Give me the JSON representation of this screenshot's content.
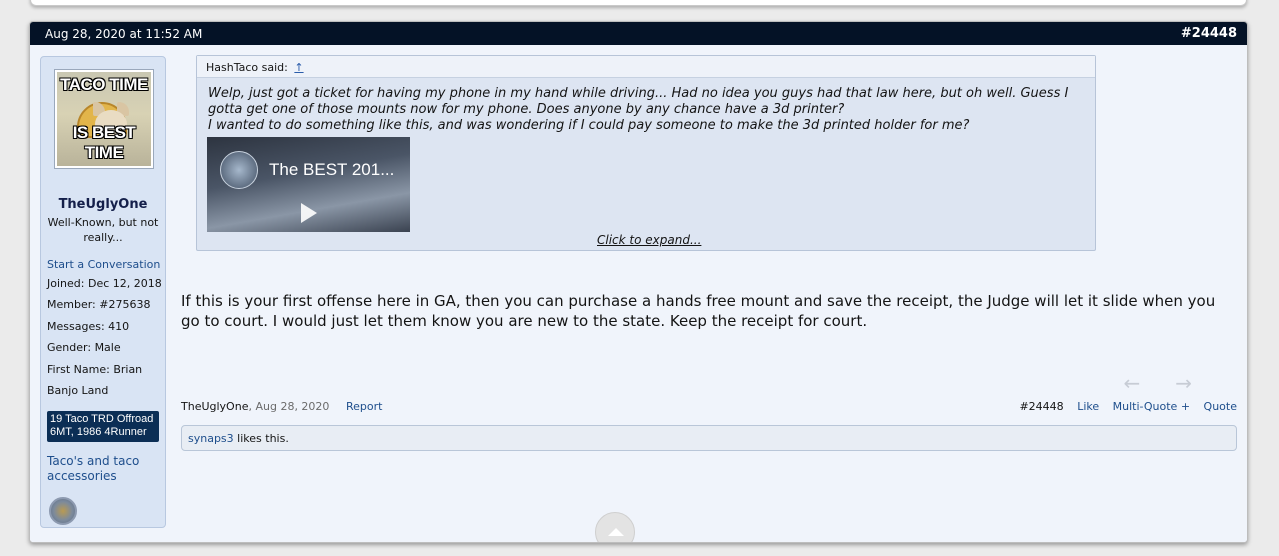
{
  "post": {
    "timestamp": "Aug 28, 2020 at 11:52 AM",
    "number": "#24448"
  },
  "user": {
    "avatar_top_text": "TACO TIME",
    "avatar_bottom_text": "IS BEST TIME",
    "name": "TheUglyOne",
    "title": "Well-Known, but not really...",
    "start_conversation": "Start a Conversation",
    "fields": [
      {
        "label": "Joined:",
        "value": "Dec 12, 2018"
      },
      {
        "label": "Member:",
        "value": "#275638"
      },
      {
        "label": "Messages:",
        "value": "410"
      },
      {
        "label": "Gender:",
        "value": "Male"
      },
      {
        "label": "First Name:",
        "value": "Brian"
      },
      {
        "label": "Banjo Land",
        "value": ""
      }
    ],
    "ride": "19 Taco TRD Offroad 6MT, 1986 4Runner",
    "link": "Taco's and taco accessories"
  },
  "quote": {
    "author_said": "HashTaco said:",
    "arrow": "↑",
    "line1": "Welp, just got a ticket for having my phone in my hand while driving... Had no idea you guys had that law here, but oh well. Guess I gotta get one of those mounts now for my phone. Does anyone by any chance have a 3d printer?",
    "line2": "I wanted to do something like this, and was wondering if I could pay someone to make the 3d printed holder for me?",
    "video_title": "The BEST 201...",
    "expand": "Click to expand..."
  },
  "message": "If this is your first offense here in GA, then you can purchase a hands free mount and save the receipt, the Judge will let it slide when you go to court. I would just let them know you are new to the state. Keep the receipt for court.",
  "footer": {
    "author": "TheUglyOne",
    "date": "Aug 28, 2020",
    "report": "Report",
    "num": "#24448",
    "like": "Like",
    "multiquote": "Multi-Quote +",
    "quote": "Quote"
  },
  "likes": {
    "who": "synaps3",
    "text": " likes this."
  },
  "nav": {
    "prev": "←",
    "next": "→"
  }
}
